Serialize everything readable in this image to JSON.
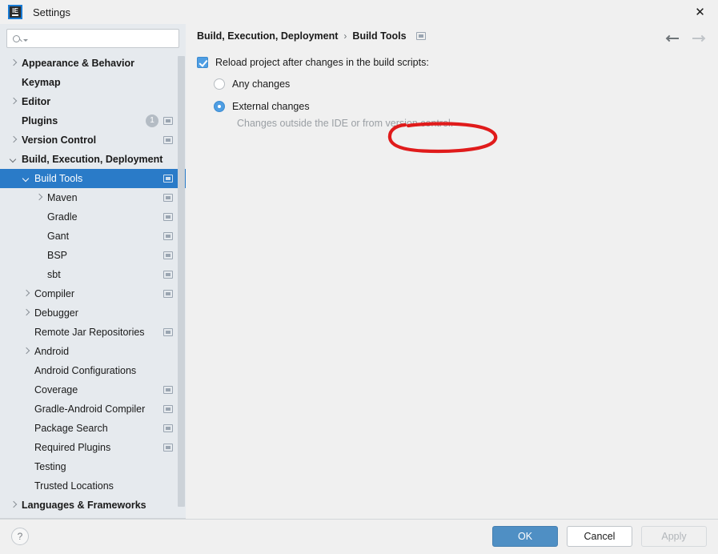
{
  "window": {
    "title": "Settings",
    "app_icon": "intellij-idea-icon",
    "icon_text": "IE",
    "close_label": "✕"
  },
  "sidebar": {
    "search": {
      "value": "",
      "placeholder": ""
    },
    "items": [
      {
        "label": "Appearance & Behavior",
        "arrow": "right",
        "indent": 0,
        "bold": true,
        "badge": null,
        "cfg": false,
        "selected": false
      },
      {
        "label": "Keymap",
        "arrow": "none",
        "indent": 0,
        "bold": true,
        "badge": null,
        "cfg": false,
        "selected": false
      },
      {
        "label": "Editor",
        "arrow": "right",
        "indent": 0,
        "bold": true,
        "badge": null,
        "cfg": false,
        "selected": false
      },
      {
        "label": "Plugins",
        "arrow": "none",
        "indent": 0,
        "bold": true,
        "badge": "1",
        "cfg": true,
        "selected": false
      },
      {
        "label": "Version Control",
        "arrow": "right",
        "indent": 0,
        "bold": true,
        "badge": null,
        "cfg": true,
        "selected": false
      },
      {
        "label": "Build, Execution, Deployment",
        "arrow": "down",
        "indent": 0,
        "bold": true,
        "badge": null,
        "cfg": false,
        "selected": false
      },
      {
        "label": "Build Tools",
        "arrow": "down",
        "indent": 1,
        "bold": false,
        "badge": null,
        "cfg": true,
        "selected": true
      },
      {
        "label": "Maven",
        "arrow": "right",
        "indent": 2,
        "bold": false,
        "badge": null,
        "cfg": true,
        "selected": false
      },
      {
        "label": "Gradle",
        "arrow": "none",
        "indent": 2,
        "bold": false,
        "badge": null,
        "cfg": true,
        "selected": false
      },
      {
        "label": "Gant",
        "arrow": "none",
        "indent": 2,
        "bold": false,
        "badge": null,
        "cfg": true,
        "selected": false
      },
      {
        "label": "BSP",
        "arrow": "none",
        "indent": 2,
        "bold": false,
        "badge": null,
        "cfg": true,
        "selected": false
      },
      {
        "label": "sbt",
        "arrow": "none",
        "indent": 2,
        "bold": false,
        "badge": null,
        "cfg": true,
        "selected": false
      },
      {
        "label": "Compiler",
        "arrow": "right",
        "indent": 1,
        "bold": false,
        "badge": null,
        "cfg": true,
        "selected": false
      },
      {
        "label": "Debugger",
        "arrow": "right",
        "indent": 1,
        "bold": false,
        "badge": null,
        "cfg": false,
        "selected": false
      },
      {
        "label": "Remote Jar Repositories",
        "arrow": "none",
        "indent": 1,
        "bold": false,
        "badge": null,
        "cfg": true,
        "selected": false
      },
      {
        "label": "Android",
        "arrow": "right",
        "indent": 1,
        "bold": false,
        "badge": null,
        "cfg": false,
        "selected": false
      },
      {
        "label": "Android Configurations",
        "arrow": "none",
        "indent": 1,
        "bold": false,
        "badge": null,
        "cfg": false,
        "selected": false
      },
      {
        "label": "Coverage",
        "arrow": "none",
        "indent": 1,
        "bold": false,
        "badge": null,
        "cfg": true,
        "selected": false
      },
      {
        "label": "Gradle-Android Compiler",
        "arrow": "none",
        "indent": 1,
        "bold": false,
        "badge": null,
        "cfg": true,
        "selected": false
      },
      {
        "label": "Package Search",
        "arrow": "none",
        "indent": 1,
        "bold": false,
        "badge": null,
        "cfg": true,
        "selected": false
      },
      {
        "label": "Required Plugins",
        "arrow": "none",
        "indent": 1,
        "bold": false,
        "badge": null,
        "cfg": true,
        "selected": false
      },
      {
        "label": "Testing",
        "arrow": "none",
        "indent": 1,
        "bold": false,
        "badge": null,
        "cfg": false,
        "selected": false
      },
      {
        "label": "Trusted Locations",
        "arrow": "none",
        "indent": 1,
        "bold": false,
        "badge": null,
        "cfg": false,
        "selected": false
      },
      {
        "label": "Languages & Frameworks",
        "arrow": "right",
        "indent": 0,
        "bold": true,
        "badge": null,
        "cfg": false,
        "selected": false
      }
    ]
  },
  "main": {
    "breadcrumb": {
      "root": "Build, Execution, Deployment",
      "separator": "›",
      "leaf": "Build Tools"
    },
    "reload_checkbox": {
      "label": "Reload project after changes in the build scripts:",
      "checked": true
    },
    "options": [
      {
        "label": "Any changes",
        "selected": false,
        "hint": ""
      },
      {
        "label": "External changes",
        "selected": true,
        "hint": "Changes outside the IDE or from version control."
      }
    ]
  },
  "footer": {
    "help_label": "?",
    "ok_label": "OK",
    "cancel_label": "Cancel",
    "apply_label": "Apply"
  },
  "colors": {
    "accent": "#2a7bc8",
    "checkbox_blue": "#4f9ee3",
    "annotation_red": "#e01b1b",
    "sidebar_bg": "#e6eaee",
    "pane_bg": "#f0f0f0"
  },
  "annotation": {
    "shape": "hand-drawn-ellipse",
    "color": "#e01b1b",
    "targets": "External changes"
  }
}
